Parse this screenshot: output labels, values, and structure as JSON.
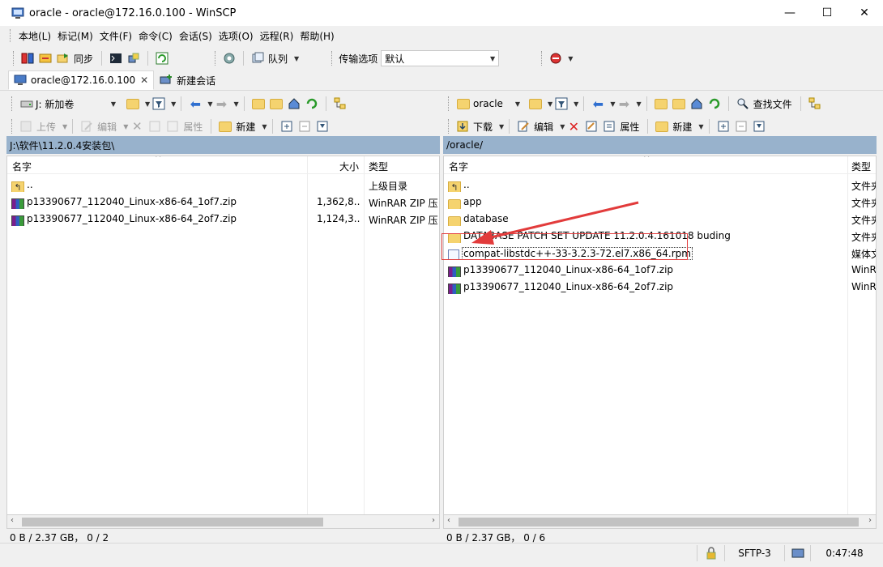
{
  "window": {
    "title": "oracle - oracle@172.16.0.100 - WinSCP",
    "min": "—",
    "max": "☐",
    "close": "✕"
  },
  "menu": [
    "本地(L)",
    "标记(M)",
    "文件(F)",
    "命令(C)",
    "会话(S)",
    "选项(O)",
    "远程(R)",
    "帮助(H)"
  ],
  "toolbar": {
    "sync_label": "同步",
    "queue_label": "队列",
    "transfer_label": "传输选项",
    "transfer_value": "默认"
  },
  "tabs": [
    {
      "label": "oracle@172.16.0.100",
      "close": "✕"
    },
    {
      "label": "新建会话"
    }
  ],
  "left": {
    "drive": "J: 新加卷",
    "upload": "上传",
    "edit": "编辑",
    "props": "属性",
    "new": "新建",
    "path": "J:\\软件\\11.2.0.4安装包\\",
    "headers": {
      "name": "名字",
      "size": "大小",
      "type": "类型"
    },
    "rows": [
      {
        "name": "..",
        "size": "",
        "type": "上级目录"
      },
      {
        "name": "p13390677_112040_Linux-x86-64_1of7.zip",
        "size": "1,362,8...",
        "type": "WinRAR ZIP 压"
      },
      {
        "name": "p13390677_112040_Linux-x86-64_2of7.zip",
        "size": "1,124,3...",
        "type": "WinRAR ZIP 压"
      }
    ],
    "status": "0 B / 2.37 GB，  0 / 2"
  },
  "right": {
    "folder": "oracle",
    "find": "查找文件",
    "download": "下载",
    "edit": "编辑",
    "props": "属性",
    "new": "新建",
    "path": "/oracle/",
    "headers": {
      "name": "名字",
      "type": "类型"
    },
    "rows": [
      {
        "name": "..",
        "type": "文件夹"
      },
      {
        "name": "app",
        "type": "文件夹"
      },
      {
        "name": "database",
        "type": "文件夹"
      },
      {
        "name": "DATABASE PATCH SET UPDATE 11.2.0.4.161018 buding",
        "type": "文件夹"
      },
      {
        "name": "compat-libstdc++-33-3.2.3-72.el7.x86_64.rpm",
        "type": "媒体文"
      },
      {
        "name": "p13390677_112040_Linux-x86-64_1of7.zip",
        "type": "WinR"
      },
      {
        "name": "p13390677_112040_Linux-x86-64_2of7.zip",
        "type": "WinR"
      }
    ],
    "status": "0 B / 2.37 GB，  0 / 6"
  },
  "statusbar": {
    "protocol": "SFTP-3",
    "time": "0:47:48"
  },
  "colors": {
    "pathbar": "#98b2cc",
    "highlight": "#e23b3b"
  }
}
